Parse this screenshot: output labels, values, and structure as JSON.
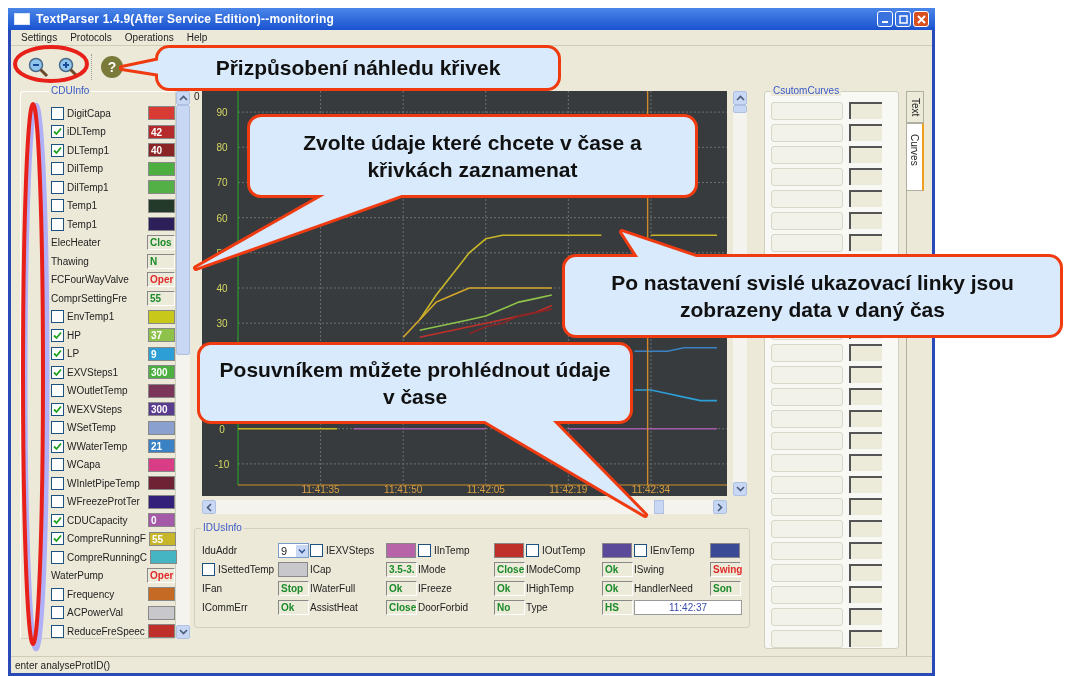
{
  "window": {
    "title": "TextParser 1.4.9(After Service Edition)--monitoring"
  },
  "menu": [
    "Settings",
    "Protocols",
    "Operations",
    "Help"
  ],
  "toolbar": {
    "help_label": "?"
  },
  "left_panel": {
    "title": "CDUInfo",
    "items": [
      {
        "kind": "check",
        "label": "DigitCapa",
        "checked": false,
        "color": "#d83a34"
      },
      {
        "kind": "check",
        "label": "iDLTemp",
        "checked": true,
        "color": "#b52a2a",
        "value": "42"
      },
      {
        "kind": "check",
        "label": "DLTemp1",
        "checked": true,
        "color": "#8b2525",
        "value": "40"
      },
      {
        "kind": "check",
        "label": "DilTemp",
        "checked": false,
        "color": "#4caf3f"
      },
      {
        "kind": "check",
        "label": "DilTemp1",
        "checked": false,
        "color": "#53b046"
      },
      {
        "kind": "check",
        "label": "Temp1",
        "checked": false,
        "color": "#233a2a"
      },
      {
        "kind": "check",
        "label": "Temp1",
        "checked": false,
        "color": "#2c1f5a"
      },
      {
        "kind": "field",
        "label": "ElecHeater",
        "value": "Clos",
        "alert": false
      },
      {
        "kind": "field",
        "label": "Thawing",
        "value": "N",
        "alert": false
      },
      {
        "kind": "field",
        "label": "FCFourWayValve",
        "value": "Oper",
        "alert": true
      },
      {
        "kind": "field",
        "label": "ComprSettingFre",
        "value": "55",
        "alert": false
      },
      {
        "kind": "check",
        "label": "EnvTemp1",
        "checked": false,
        "color": "#c8c81a"
      },
      {
        "kind": "check",
        "label": "HP",
        "checked": true,
        "color": "#8fc24a",
        "value": "37"
      },
      {
        "kind": "check",
        "label": "LP",
        "checked": true,
        "color": "#2e9fd6",
        "value": "9"
      },
      {
        "kind": "check",
        "label": "EXVSteps1",
        "checked": true,
        "color": "#4caf3f",
        "value": "300"
      },
      {
        "kind": "check",
        "label": "WOutletTemp",
        "checked": false,
        "color": "#7a3558"
      },
      {
        "kind": "check",
        "label": "WEXVSteps",
        "checked": true,
        "color": "#5b3d8f",
        "value": "300"
      },
      {
        "kind": "check",
        "label": "WSetTemp",
        "checked": false,
        "color": "#8aa0cf"
      },
      {
        "kind": "check",
        "label": "WWaterTemp",
        "checked": true,
        "color": "#3b82c4",
        "value": "21"
      },
      {
        "kind": "check",
        "label": "WCapa",
        "checked": false,
        "color": "#d93d86"
      },
      {
        "kind": "check",
        "label": "WInletPipeTemp",
        "checked": false,
        "color": "#6e2233"
      },
      {
        "kind": "check",
        "label": "WFreezeProtTer",
        "checked": false,
        "color": "#33207a"
      },
      {
        "kind": "check",
        "label": "CDUCapacity",
        "checked": true,
        "color": "#a45aa8",
        "value": "0"
      },
      {
        "kind": "check",
        "label": "CompreRunningF",
        "checked": true,
        "color": "#c8b62a",
        "value": "55"
      },
      {
        "kind": "check",
        "label": "CompreRunningC",
        "checked": false,
        "color": "#45b5c4"
      },
      {
        "kind": "field",
        "label": "WaterPump",
        "value": "Oper",
        "alert": true
      },
      {
        "kind": "check",
        "label": "Frequency",
        "checked": false,
        "color": "#c46a24"
      },
      {
        "kind": "check",
        "label": "ACPowerVal",
        "checked": false,
        "color": "#c8c8cc"
      },
      {
        "kind": "check",
        "label": "ReduceFreSpeec",
        "checked": false,
        "color": "#c0302a"
      }
    ]
  },
  "chart_panel": {
    "corner_label": "0",
    "chart_data": {
      "type": "line",
      "categories": [
        null,
        null,
        null,
        null,
        null,
        "11:41:35",
        null,
        null,
        null,
        null,
        "11:41:50",
        null,
        null,
        null,
        null,
        "11:42:05",
        null,
        null,
        null,
        null,
        "11:42:19",
        null,
        null,
        null,
        null,
        "11:42:34",
        null,
        null,
        null,
        null
      ],
      "ylim": [
        -16,
        96
      ],
      "grid": true,
      "yticks": [
        -10,
        0,
        30,
        40,
        50,
        60,
        70,
        80,
        90
      ],
      "series": [
        {
          "color": "#c8b62a",
          "values": [
            0,
            0,
            0,
            0,
            0,
            0,
            0,
            null,
            null,
            null,
            null,
            31,
            38,
            44,
            50,
            54,
            55,
            55,
            55,
            55,
            55,
            55,
            55,
            null,
            null,
            55,
            55,
            55,
            55,
            55
          ]
        },
        {
          "color": "#d4a82a",
          "values": [
            null,
            null,
            null,
            null,
            null,
            null,
            null,
            null,
            null,
            null,
            26,
            31,
            36,
            38,
            40,
            40,
            40,
            40,
            40,
            40,
            null,
            null,
            null,
            null,
            null,
            null,
            null,
            null,
            null,
            null
          ]
        },
        {
          "color": "#8fc24a",
          "values": [
            null,
            null,
            null,
            null,
            null,
            null,
            null,
            null,
            null,
            null,
            null,
            28,
            29,
            30,
            31,
            32,
            34,
            36,
            37,
            38,
            null,
            null,
            null,
            null,
            null,
            null,
            null,
            null,
            null,
            null
          ]
        },
        {
          "color": "#c0302a",
          "values": [
            null,
            null,
            null,
            null,
            null,
            null,
            null,
            null,
            null,
            null,
            null,
            26,
            27,
            28,
            29,
            30,
            31,
            32,
            33,
            35,
            null,
            null,
            null,
            null,
            null,
            null,
            null,
            null,
            null,
            null
          ]
        },
        {
          "color": "#8b2525",
          "values": [
            null,
            null,
            null,
            null,
            null,
            null,
            null,
            null,
            null,
            null,
            null,
            null,
            null,
            null,
            27,
            29,
            30,
            32,
            33,
            34,
            null,
            null,
            null,
            null,
            null,
            null,
            null,
            null,
            null,
            null
          ]
        },
        {
          "color": "#3b82c4",
          "values": [
            null,
            null,
            null,
            null,
            null,
            null,
            null,
            null,
            null,
            null,
            null,
            null,
            null,
            null,
            null,
            null,
            null,
            null,
            null,
            null,
            null,
            null,
            null,
            null,
            22,
            22,
            22,
            23,
            23,
            23
          ]
        },
        {
          "color": "#2e9fd6",
          "values": [
            null,
            null,
            null,
            null,
            null,
            null,
            null,
            null,
            null,
            null,
            null,
            null,
            null,
            null,
            null,
            null,
            null,
            null,
            null,
            null,
            null,
            null,
            null,
            null,
            11,
            11,
            10,
            9,
            8,
            8
          ]
        },
        {
          "color": "#a45aa8",
          "values": [
            null,
            null,
            null,
            null,
            null,
            null,
            null,
            0,
            0,
            0,
            0,
            0,
            0,
            0,
            0,
            0,
            null,
            null,
            null,
            null,
            0,
            0,
            0,
            0,
            0,
            0,
            0,
            0,
            0,
            0
          ]
        }
      ]
    }
  },
  "idu_panel": {
    "title": "IDUsInfo",
    "rows": [
      [
        {
          "kind": "select",
          "label": "IduAddr",
          "value": "9"
        },
        {
          "kind": "check",
          "label": "IEXVSteps",
          "checked": false,
          "color": "#b864a8"
        },
        {
          "kind": "check",
          "label": "IInTemp",
          "checked": false,
          "color": "#c0302a"
        },
        {
          "kind": "check",
          "label": "IOutTemp",
          "checked": false,
          "color": "#5b4a9a"
        },
        {
          "kind": "check",
          "label": "IEnvTemp",
          "checked": false,
          "color": "#3a4a94"
        }
      ],
      [
        {
          "kind": "check",
          "label": "ISettedTemp",
          "checked": false,
          "color": "#c8c8cc"
        },
        {
          "kind": "value",
          "label": "ICap",
          "value": "3.5-3.",
          "alert": false
        },
        {
          "kind": "value",
          "label": "IMode",
          "value": "Close",
          "alert": false
        },
        {
          "kind": "value",
          "label": "IModeComp",
          "value": "Ok",
          "alert": false
        },
        {
          "kind": "value",
          "label": "ISwing",
          "value": "Swing",
          "alert": true
        }
      ],
      [
        {
          "kind": "value",
          "label": "IFan",
          "value": "Stop",
          "alert": false
        },
        {
          "kind": "value",
          "label": "IWaterFull",
          "value": "Ok",
          "alert": false
        },
        {
          "kind": "value",
          "label": "IFreeze",
          "value": "Ok",
          "alert": false
        },
        {
          "kind": "value",
          "label": "IHighTemp",
          "value": "Ok",
          "alert": false
        },
        {
          "kind": "value",
          "label": "HandlerNeed",
          "value": "Son",
          "alert": false
        }
      ],
      [
        {
          "kind": "value",
          "label": "ICommErr",
          "value": "Ok",
          "alert": false
        },
        {
          "kind": "value",
          "label": "AssistHeat",
          "value": "Close",
          "alert": false
        },
        {
          "kind": "value",
          "label": "DoorForbid",
          "value": "No",
          "alert": false
        },
        {
          "kind": "value",
          "label": "Type",
          "value": "HS",
          "alert": false
        },
        {
          "kind": "time",
          "value": "11:42:37"
        }
      ]
    ]
  },
  "curves_panel": {
    "title": "CsutomCurves"
  },
  "side_tabs": [
    {
      "label": "Text",
      "selected": false
    },
    {
      "label": "Curves",
      "selected": true
    }
  ],
  "status_bar": "enter analyseProtID()",
  "callouts": [
    {
      "text": "Přizpůsobení náhledu křivek"
    },
    {
      "text": "Zvolte údaje které chcete v čase a křivkách zaznamenat"
    },
    {
      "text": "Po nastavení svislé ukazovací linky jsou zobrazeny data v daný čas"
    },
    {
      "text": "Posuvníkem můžete prohlédnout údaje v čase"
    }
  ]
}
